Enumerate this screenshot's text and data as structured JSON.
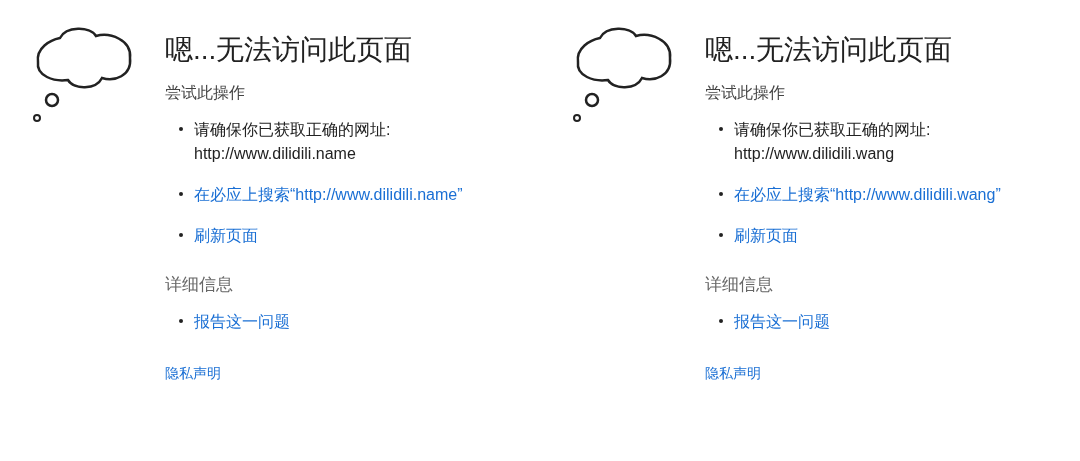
{
  "panels": [
    {
      "title": "嗯...无法访问此页面",
      "try_heading": "尝试此操作",
      "items": [
        {
          "kind": "text",
          "text": "请确保你已获取正确的网址:",
          "url": "http://www.dilidili.name"
        },
        {
          "kind": "link",
          "text": "在必应上搜索“http://www.dilidili.name”"
        },
        {
          "kind": "link",
          "text": "刷新页面"
        }
      ],
      "details_heading": "详细信息",
      "details_items": [
        {
          "kind": "link",
          "text": "报告这一问题"
        }
      ],
      "privacy_link": "隐私声明"
    },
    {
      "title": "嗯...无法访问此页面",
      "try_heading": "尝试此操作",
      "items": [
        {
          "kind": "text",
          "text": "请确保你已获取正确的网址:",
          "url": "http://www.dilidili.wang"
        },
        {
          "kind": "link",
          "text": "在必应上搜索“http://www.dilidili.wang”"
        },
        {
          "kind": "link",
          "text": "刷新页面"
        }
      ],
      "details_heading": "详细信息",
      "details_items": [
        {
          "kind": "link",
          "text": "报告这一问题"
        }
      ],
      "privacy_link": "隐私声明"
    }
  ]
}
